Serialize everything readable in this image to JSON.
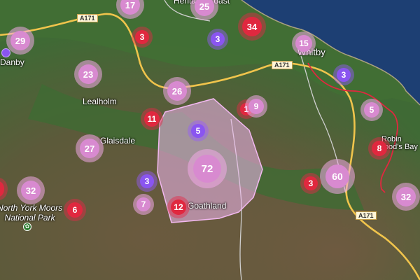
{
  "places": {
    "heritage_coast": "Heritage Coast",
    "whitby": "Whitby",
    "danby": "Danby",
    "lealholm": "Lealholm",
    "glaisdale": "Glaisdale",
    "goathland": "Goathland",
    "robin_hoods_bay": [
      "Robin",
      "Hood's Bay"
    ],
    "north_york_moors": [
      "North York Moors",
      "National Park"
    ]
  },
  "roads": {
    "a171_west": "A171",
    "a171_east": "A171",
    "a171_south": "A171"
  },
  "colors": {
    "land": "#3f6a35",
    "moor": "#6b5a3f",
    "sea": "#1d3f73",
    "road": "#f0c44c",
    "route": "#e0283f",
    "polygon_fill": "#f2b8f0",
    "cluster_red": "#e0283f",
    "cluster_purple": "#8a55f0",
    "cluster_pink": "#d88ad0"
  },
  "clusters": [
    {
      "id": "c17",
      "count": "17",
      "color": "pink"
    },
    {
      "id": "c25",
      "count": "25",
      "color": "pink"
    },
    {
      "id": "c3a",
      "count": "3",
      "color": "red"
    },
    {
      "id": "c3b",
      "count": "3",
      "color": "purple"
    },
    {
      "id": "c34",
      "count": "34",
      "color": "red"
    },
    {
      "id": "c15",
      "count": "15",
      "color": "pink"
    },
    {
      "id": "c29",
      "count": "29",
      "color": "pink"
    },
    {
      "id": "c3c",
      "count": "3",
      "color": "purple"
    },
    {
      "id": "c23",
      "count": "23",
      "color": "pink"
    },
    {
      "id": "c26",
      "count": "26",
      "color": "pink"
    },
    {
      "id": "c11",
      "count": "11",
      "color": "red"
    },
    {
      "id": "c1x",
      "count": "1",
      "color": "red"
    },
    {
      "id": "c9",
      "count": "9",
      "color": "pink"
    },
    {
      "id": "c5a",
      "count": "5",
      "color": "pink"
    },
    {
      "id": "c5b",
      "count": "5",
      "color": "purple"
    },
    {
      "id": "c27",
      "count": "27",
      "color": "pink"
    },
    {
      "id": "c72",
      "count": "72",
      "color": "pink"
    },
    {
      "id": "c8",
      "count": "8",
      "color": "red"
    },
    {
      "id": "c3d",
      "count": "3",
      "color": "purple"
    },
    {
      "id": "c60",
      "count": "60",
      "color": "pink"
    },
    {
      "id": "c3e",
      "count": "3",
      "color": "red"
    },
    {
      "id": "c32a",
      "count": "32",
      "color": "pink"
    },
    {
      "id": "c32b",
      "count": "32",
      "color": "pink"
    },
    {
      "id": "c7",
      "count": "7",
      "color": "pink"
    },
    {
      "id": "c12",
      "count": "12",
      "color": "red"
    },
    {
      "id": "c6",
      "count": "6",
      "color": "red"
    }
  ]
}
